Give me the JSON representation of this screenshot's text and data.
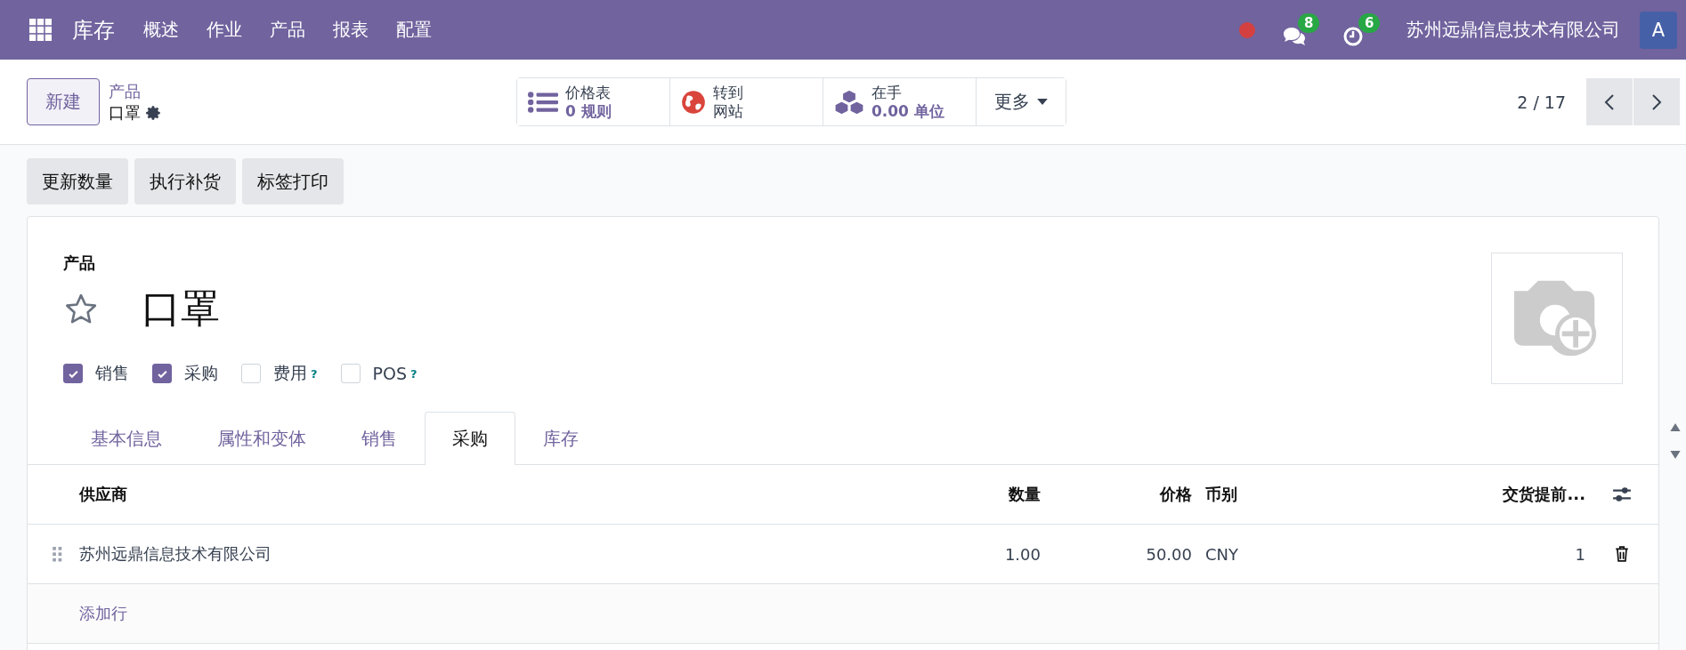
{
  "navbar": {
    "app_name": "库存",
    "menu": [
      "概述",
      "作业",
      "产品",
      "报表",
      "配置"
    ],
    "messages_count": "8",
    "activities_count": "6",
    "company": "苏州远鼎信息技术有限公司",
    "avatar_letter": "A"
  },
  "control_panel": {
    "new_button": "新建",
    "breadcrumb_parent": "产品",
    "breadcrumb_current": "口罩",
    "stat_buttons": [
      {
        "kind": "pricelist",
        "top": "价格表",
        "bottom": "0 规则"
      },
      {
        "kind": "website",
        "top": "转到",
        "bottom": "网站"
      },
      {
        "kind": "onhand",
        "top": "在手",
        "bottom": "0.00 单位"
      }
    ],
    "more_button": "更多",
    "pager": "2 / 17"
  },
  "actions": [
    "更新数量",
    "执行补货",
    "标签打印"
  ],
  "form": {
    "label": "产品",
    "favorite": false,
    "name": "口罩",
    "options": [
      {
        "label": "销售",
        "checked": true
      },
      {
        "label": "采购",
        "checked": true
      },
      {
        "label": "费用",
        "checked": false,
        "help": "?"
      },
      {
        "label": "POS",
        "checked": false,
        "help": "?"
      }
    ],
    "tabs": [
      {
        "label": "基本信息",
        "selected": false
      },
      {
        "label": "属性和变体",
        "selected": false
      },
      {
        "label": "销售",
        "selected": false
      },
      {
        "label": "采购",
        "selected": true
      },
      {
        "label": "库存",
        "selected": false
      }
    ],
    "table": {
      "columns": [
        "供应商",
        "数量",
        "价格",
        "币别",
        "交货提前..."
      ],
      "rows": [
        {
          "supplier": "苏州远鼎信息技术有限公司",
          "quantity": "1.00",
          "price": "50.00",
          "currency": "CNY",
          "lead_time": "1"
        }
      ],
      "add_line": "添加行"
    }
  }
}
